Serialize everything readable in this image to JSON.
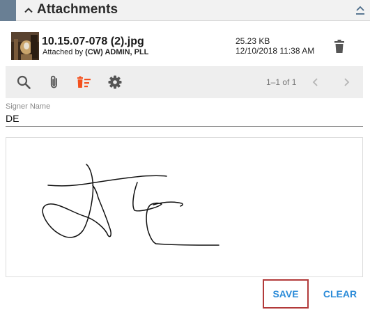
{
  "section": {
    "title": "Attachments"
  },
  "attachment": {
    "file_name": "10.15.07-078 (2).jpg",
    "attached_by_prefix": "Attached by ",
    "attached_by_user": "(CW) ADMIN, PLL",
    "size": "25.23 KB",
    "date": "12/10/2018 11:38 AM"
  },
  "toolbar": {
    "icons": [
      "search-icon",
      "paperclip-icon",
      "delete-list-icon",
      "gear-icon"
    ],
    "delete_accent": "#f4511e",
    "pager_text": "1–1 of 1"
  },
  "signer": {
    "label": "Signer Name",
    "value": "DE"
  },
  "actions": {
    "save_label": "SAVE",
    "clear_label": "CLEAR"
  },
  "colors": {
    "accent_bar": "#697f94",
    "link_blue": "#2b8bd8",
    "focus_red": "#b23a3a"
  }
}
